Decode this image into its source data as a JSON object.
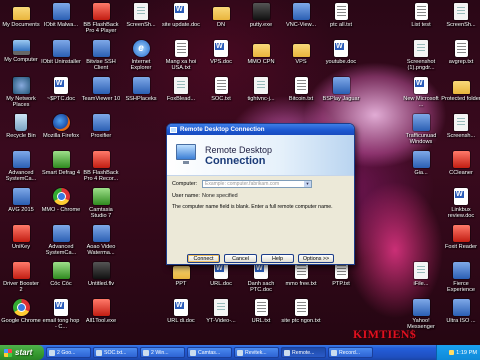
{
  "desktop": {
    "icons": [
      {
        "label": "My Documents",
        "glyph": "folder"
      },
      {
        "label": "IObit Malwa...",
        "glyph": "app"
      },
      {
        "label": "BB FlashBack Pro 4 Player",
        "glyph": "red"
      },
      {
        "label": "ScreenSh...",
        "glyph": "doc"
      },
      {
        "label": "site update.doc",
        "glyph": "word"
      },
      {
        "label": "DN",
        "glyph": "folder"
      },
      {
        "label": "putty.exe",
        "glyph": "dark"
      },
      {
        "label": "VNC-View...",
        "glyph": "app"
      },
      {
        "label": "ptc all.txt",
        "glyph": "txt"
      },
      {
        "label": "List test",
        "glyph": "txt"
      },
      {
        "label": "ScreenSh...",
        "glyph": "doc"
      },
      {
        "label": "My Computer",
        "glyph": "pc"
      },
      {
        "label": "IObit Uninstaller",
        "glyph": "app"
      },
      {
        "label": "Bitvise SSH Client",
        "glyph": "app"
      },
      {
        "label": "Internet Explorer",
        "glyph": "ie"
      },
      {
        "label": "Mang xa hoi USA.txt",
        "glyph": "txt"
      },
      {
        "label": "VPS.doc",
        "glyph": "word"
      },
      {
        "label": "MMO CPN",
        "glyph": "folder"
      },
      {
        "label": "VPS",
        "glyph": "folder"
      },
      {
        "label": "youtube.doc",
        "glyph": "word"
      },
      {
        "label": "Screenshot (1).pngdr...",
        "glyph": "doc"
      },
      {
        "label": "avgrep.txt",
        "glyph": "txt"
      },
      {
        "label": "My Network Places",
        "glyph": "net"
      },
      {
        "label": "~$PTC.doc",
        "glyph": "word"
      },
      {
        "label": "TeamViewer 10",
        "glyph": "app"
      },
      {
        "label": "SSHPlaceks",
        "glyph": "app"
      },
      {
        "label": "FoxBlead...",
        "glyph": "doc"
      },
      {
        "label": "SOC.txt",
        "glyph": "txt"
      },
      {
        "label": "tightvnc-j...",
        "glyph": "doc"
      },
      {
        "label": "Bitcoin.txt",
        "glyph": "txt"
      },
      {
        "label": "BSPlay Jaguar",
        "glyph": "app"
      },
      {
        "label": "New Microsoft ...",
        "glyph": "word"
      },
      {
        "label": "Protected folder",
        "glyph": "folder"
      },
      {
        "label": "Recycle Bin",
        "glyph": "bin"
      },
      {
        "label": "Mozilla Firefox",
        "glyph": "ff"
      },
      {
        "label": "Proxifier",
        "glyph": "app"
      },
      {
        "label": "Trafficunuad Windows",
        "glyph": "app"
      },
      {
        "label": "Screensh...",
        "glyph": "doc"
      },
      {
        "label": "Advanced SystemCa...",
        "glyph": "app"
      },
      {
        "label": "Smart Defrag 4",
        "glyph": "green"
      },
      {
        "label": "BB FlashBack Pro 4 Recor...",
        "glyph": "red"
      },
      {
        "label": "Gia...",
        "glyph": "app"
      },
      {
        "label": "CCleaner",
        "glyph": "red"
      },
      {
        "label": "AVG 2015",
        "glyph": "app"
      },
      {
        "label": "MMO - Chrome",
        "glyph": "chrome"
      },
      {
        "label": "Camtasia Studio 7",
        "glyph": "green"
      },
      {
        "label": "Linkbux review.doc",
        "glyph": "word"
      },
      {
        "label": "UniKey",
        "glyph": "red"
      },
      {
        "label": "Advanced SystemCa...",
        "glyph": "app"
      },
      {
        "label": "Aoao Video Waterma...",
        "glyph": "app"
      },
      {
        "label": "youtub...",
        "glyph": "word"
      },
      {
        "label": "MoneyStore",
        "glyph": "folder"
      },
      {
        "label": "BSPlay...",
        "glyph": "doc"
      },
      {
        "label": "Foxit Reader",
        "glyph": "red"
      },
      {
        "label": "Driver Booster 2",
        "glyph": "red"
      },
      {
        "label": "Cốc Cốc",
        "glyph": "green"
      },
      {
        "label": "Untitled.flv",
        "glyph": "dark"
      },
      {
        "label": "PPT",
        "glyph": "folder"
      },
      {
        "label": "URL.doc",
        "glyph": "word"
      },
      {
        "label": "Danh sach PTC.doc",
        "glyph": "word"
      },
      {
        "label": "mmo free.txt",
        "glyph": "txt"
      },
      {
        "label": "PTP.txt",
        "glyph": "txt"
      },
      {
        "label": "iFile...",
        "glyph": "doc"
      },
      {
        "label": "Fierce Experience",
        "glyph": "app"
      },
      {
        "label": "Google Chrome",
        "glyph": "chrome"
      },
      {
        "label": "email tong hop - C...",
        "glyph": "word"
      },
      {
        "label": "All1Tool.exe",
        "glyph": "red"
      },
      {
        "label": "URL di.doc",
        "glyph": "word"
      },
      {
        "label": "YT-Video-...",
        "glyph": "doc"
      },
      {
        "label": "URL.txt",
        "glyph": "txt"
      },
      {
        "label": "site ptc ngon.txt",
        "glyph": "txt"
      },
      {
        "label": "Yahoo! Messenger",
        "glyph": "app"
      },
      {
        "label": "Ultra ISO ...",
        "glyph": "app"
      }
    ]
  },
  "dialog": {
    "title": "Remote Desktop Connection",
    "header_line1": "Remote Desktop",
    "header_line2": "Connection",
    "computer_label": "Computer:",
    "computer_placeholder": "Example: computer.fabrikam.com",
    "username_label": "User name:",
    "username_value": "None specified",
    "message": "The computer name field is blank. Enter a full remote computer name.",
    "buttons": {
      "connect": "Connect",
      "cancel": "Cancel",
      "help": "Help",
      "options": "Options >>"
    }
  },
  "watermark": "KIMTIEN$",
  "taskbar": {
    "start_label": "start",
    "tasks": [
      {
        "label": "2 Goo...",
        "active": false
      },
      {
        "label": "SOC.txt...",
        "active": false
      },
      {
        "label": "2 Win...",
        "active": false
      },
      {
        "label": "Camtas...",
        "active": false
      },
      {
        "label": "Revitek...",
        "active": false
      },
      {
        "label": "Remote...",
        "active": true
      },
      {
        "label": "Record...",
        "active": false
      }
    ],
    "clock": "1:19 PM"
  }
}
